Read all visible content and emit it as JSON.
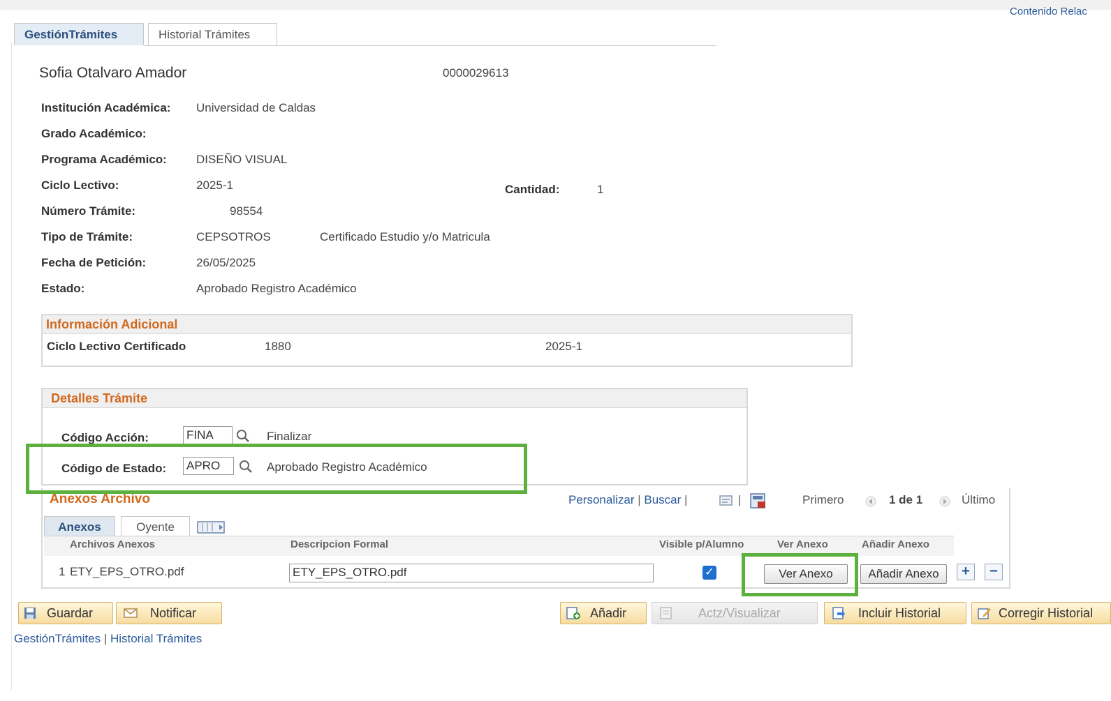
{
  "top": {
    "related_content": "Contenido Relac"
  },
  "tabs": [
    {
      "label": "GestiónTrámites"
    },
    {
      "label": "Historial Trámites"
    }
  ],
  "student": {
    "name": "Sofia  Otalvaro Amador",
    "id": "0000029613"
  },
  "fields": {
    "institucion": {
      "label": "Institución Académica:",
      "value": "Universidad de Caldas"
    },
    "grado": {
      "label": "Grado Académico:",
      "value": ""
    },
    "programa": {
      "label": "Programa Académico:",
      "value": "DISEÑO VISUAL"
    },
    "ciclo": {
      "label": "Ciclo Lectivo:",
      "value": "2025-1"
    },
    "cantidad": {
      "label": "Cantidad:",
      "value": "1"
    },
    "numero": {
      "label": "Número Trámite:",
      "value": "98554"
    },
    "tipo": {
      "label": "Tipo de Trámite:",
      "value": "CEPSOTROS",
      "description": "Certificado Estudio y/o Matricula"
    },
    "fecha": {
      "label": "Fecha de Petición:",
      "value": "26/05/2025"
    },
    "estado": {
      "label": "Estado:",
      "value": "Aprobado Registro Académico"
    }
  },
  "info_adicional": {
    "title": "Información Adicional",
    "row_label": "Ciclo Lectivo Certificado",
    "code": "1880",
    "value": "2025-1"
  },
  "detalles": {
    "title": "Detalles Trámite",
    "accion": {
      "label": "Código Acción:",
      "value": "FINA",
      "description": "Finalizar"
    },
    "estado": {
      "label": "Código de Estado:",
      "value": "APRO",
      "description": "Aprobado Registro Académico"
    }
  },
  "anexos": {
    "title": "Anexos Archivo",
    "personalizar": "Personalizar",
    "buscar": "Buscar",
    "sep": "|",
    "primero": "Primero",
    "range": "1 de 1",
    "ultimo": "Último",
    "subtabs": [
      {
        "label": "Anexos"
      },
      {
        "label": "Oyente"
      }
    ],
    "columns": [
      "Archivos Anexos",
      "Descripcion Formal",
      "Visible p/Alumno",
      "Ver Anexo",
      "Añadir Anexo"
    ],
    "rows": [
      {
        "num": "1",
        "file": "ETY_EPS_OTRO.pdf",
        "description": "ETY_EPS_OTRO.pdf",
        "visible": true,
        "view_label": "Ver Anexo",
        "add_label": "Añadir Anexo"
      }
    ]
  },
  "buttons": {
    "guardar": "Guardar",
    "notificar": "Notificar",
    "anadir": "Añadir",
    "actualizar": "Actz/Visualizar",
    "incluir": "Incluir Historial",
    "corregir": "Corregir Historial"
  },
  "footer": {
    "link1": "GestiónTrámites",
    "sep": " | ",
    "link2": "Historial Trámites"
  },
  "colors": {
    "accent_orange": "#d2691e",
    "link_blue": "#2b5a9a",
    "highlight_green": "#5cb03c"
  }
}
